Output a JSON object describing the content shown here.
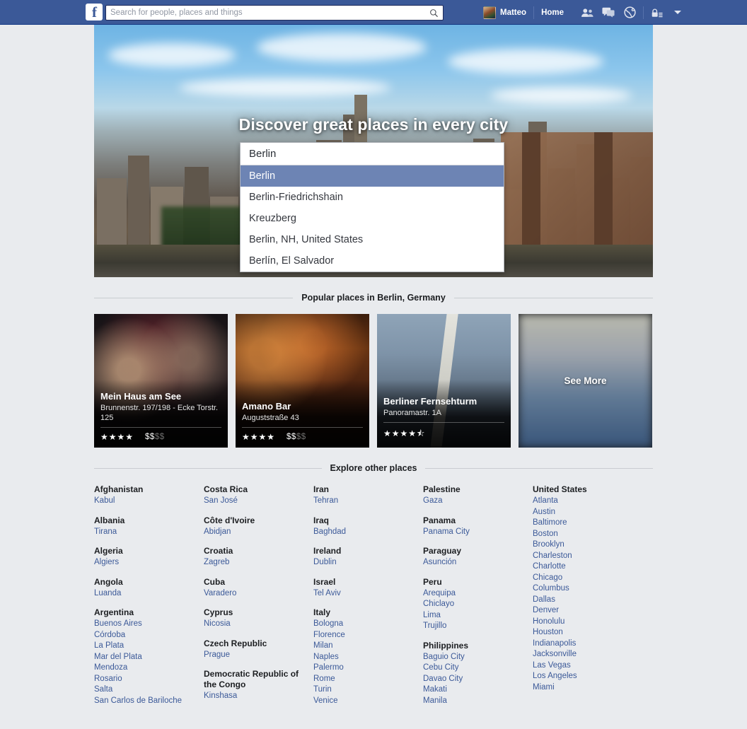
{
  "header": {
    "logo": "f",
    "search": {
      "placeholder": "Search for people, places and things",
      "value": "",
      "icon": "search-icon"
    },
    "user_name": "Matteo",
    "home_label": "Home",
    "icons": [
      "friend-requests-icon",
      "messages-icon",
      "notifications-globe-icon",
      "privacy-lock-icon",
      "account-caret-icon"
    ],
    "brand_color": "#3b5998"
  },
  "hero": {
    "title": "Discover great places in every city",
    "typeahead": {
      "input_value": "Berlin",
      "selected_index": 0,
      "highlight_color": "#6d84b4",
      "suggestions": [
        "Berlin",
        "Berlin-Friedrichshain",
        "Kreuzberg",
        "Berlin, NH, United States",
        "Berlín, El Salvador"
      ]
    }
  },
  "popular": {
    "heading": "Popular places in Berlin, Germany",
    "cards": [
      {
        "name": "Mein Haus am See",
        "address": "Brunnenstr. 197/198 - Ecke Torstr. 125",
        "stars": "★★★★",
        "price_on": "$$",
        "price_off": "$$"
      },
      {
        "name": "Amano Bar",
        "address": "Auguststraße 43",
        "stars": "★★★★",
        "price_on": "$$",
        "price_off": "$$"
      },
      {
        "name": "Berliner Fernsehturm",
        "address": "Panoramastr. 1A",
        "stars": "★★★★⯪",
        "price_on": "",
        "price_off": ""
      }
    ],
    "see_more_label": "See More"
  },
  "explore": {
    "heading": "Explore other places",
    "link_color": "#3b5998",
    "columns": [
      [
        {
          "country": "Afghanistan",
          "cities": [
            "Kabul"
          ]
        },
        {
          "country": "Albania",
          "cities": [
            "Tirana"
          ]
        },
        {
          "country": "Algeria",
          "cities": [
            "Algiers"
          ]
        },
        {
          "country": "Angola",
          "cities": [
            "Luanda"
          ]
        },
        {
          "country": "Argentina",
          "cities": [
            "Buenos Aires",
            "Córdoba",
            "La Plata",
            "Mar del Plata",
            "Mendoza",
            "Rosario",
            "Salta",
            "San Carlos de Bariloche"
          ]
        }
      ],
      [
        {
          "country": "Costa Rica",
          "cities": [
            "San José"
          ]
        },
        {
          "country": "Côte d'Ivoire",
          "cities": [
            "Abidjan"
          ]
        },
        {
          "country": "Croatia",
          "cities": [
            "Zagreb"
          ]
        },
        {
          "country": "Cuba",
          "cities": [
            "Varadero"
          ]
        },
        {
          "country": "Cyprus",
          "cities": [
            "Nicosia"
          ]
        },
        {
          "country": "Czech Republic",
          "cities": [
            "Prague"
          ]
        },
        {
          "country": "Democratic Republic of the Congo",
          "cities": [
            "Kinshasa"
          ]
        }
      ],
      [
        {
          "country": "Iran",
          "cities": [
            "Tehran"
          ]
        },
        {
          "country": "Iraq",
          "cities": [
            "Baghdad"
          ]
        },
        {
          "country": "Ireland",
          "cities": [
            "Dublin"
          ]
        },
        {
          "country": "Israel",
          "cities": [
            "Tel Aviv"
          ]
        },
        {
          "country": "Italy",
          "cities": [
            "Bologna",
            "Florence",
            "Milan",
            "Naples",
            "Palermo",
            "Rome",
            "Turin",
            "Venice"
          ]
        }
      ],
      [
        {
          "country": "Palestine",
          "cities": [
            "Gaza"
          ]
        },
        {
          "country": "Panama",
          "cities": [
            "Panama City"
          ]
        },
        {
          "country": "Paraguay",
          "cities": [
            "Asunción"
          ]
        },
        {
          "country": "Peru",
          "cities": [
            "Arequipa",
            "Chiclayo",
            "Lima",
            "Trujillo"
          ]
        },
        {
          "country": "Philippines",
          "cities": [
            "Baguio City",
            "Cebu City",
            "Davao City",
            "Makati",
            "Manila"
          ]
        }
      ],
      [
        {
          "country": "United States",
          "cities": [
            "Atlanta",
            "Austin",
            "Baltimore",
            "Boston",
            "Brooklyn",
            "Charleston",
            "Charlotte",
            "Chicago",
            "Columbus",
            "Dallas",
            "Denver",
            "Honolulu",
            "Houston",
            "Indianapolis",
            "Jacksonville",
            "Las Vegas",
            "Los Angeles",
            "Miami"
          ]
        }
      ]
    ]
  }
}
